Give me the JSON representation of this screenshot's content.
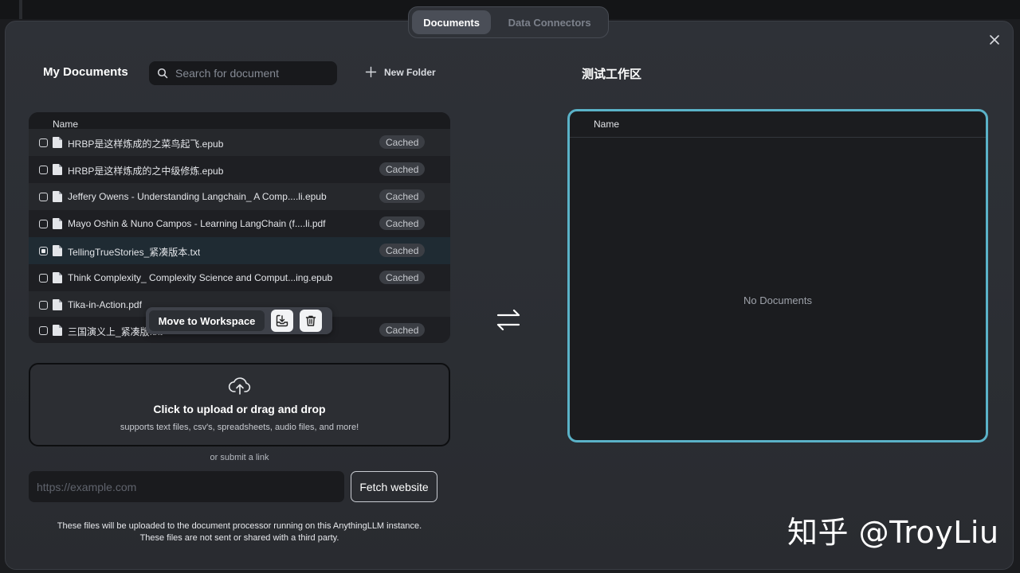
{
  "tabs": [
    {
      "label": "Documents",
      "active": true
    },
    {
      "label": "Data Connectors",
      "active": false
    }
  ],
  "my_documents": {
    "title": "My Documents",
    "search_placeholder": "Search for document",
    "new_folder_label": "New Folder",
    "column_name": "Name",
    "files": [
      {
        "name": "HRBP是这样炼成的之菜鸟起飞.epub",
        "status": "Cached",
        "checked": false
      },
      {
        "name": "HRBP是这样炼成的之中级修炼.epub",
        "status": "Cached",
        "checked": false
      },
      {
        "name": "Jeffery Owens - Understanding Langchain_ A Comp....li.epub",
        "status": "Cached",
        "checked": false
      },
      {
        "name": "Mayo Oshin & Nuno Campos - Learning LangChain (f....li.pdf",
        "status": "Cached",
        "checked": false
      },
      {
        "name": "TellingTrueStories_紧凑版本.txt",
        "status": "Cached",
        "checked": true
      },
      {
        "name": "Think Complexity_ Complexity Science and Comput...ing.epub",
        "status": "Cached",
        "checked": false
      },
      {
        "name": "Tika-in-Action.pdf",
        "status": "",
        "checked": false
      },
      {
        "name": "三国演义上_紧凑版.txt",
        "status": "Cached",
        "checked": false
      }
    ]
  },
  "popover": {
    "move_label": "Move to Workspace",
    "icons": [
      "move-to-workspace-icon",
      "trash-icon"
    ]
  },
  "upload": {
    "title": "Click to upload or drag and drop",
    "subtitle": "supports text files, csv's, spreadsheets, audio files, and more!",
    "or_link": "or submit a link",
    "url_placeholder": "https://example.com",
    "fetch_label": "Fetch website",
    "disclaimer_line1": "These files will be uploaded to the document processor running on this AnythingLLM instance.",
    "disclaimer_line2": "These files are not sent or shared with a third party."
  },
  "workspace": {
    "title": "测试工作区",
    "column_name": "Name",
    "empty_text": "No Documents"
  },
  "watermark": "知乎 @TroyLiu",
  "colors": {
    "accent_border": "#5ab2c8",
    "modal_bg": "#2e3137",
    "selected_row": "#1f2b33"
  }
}
